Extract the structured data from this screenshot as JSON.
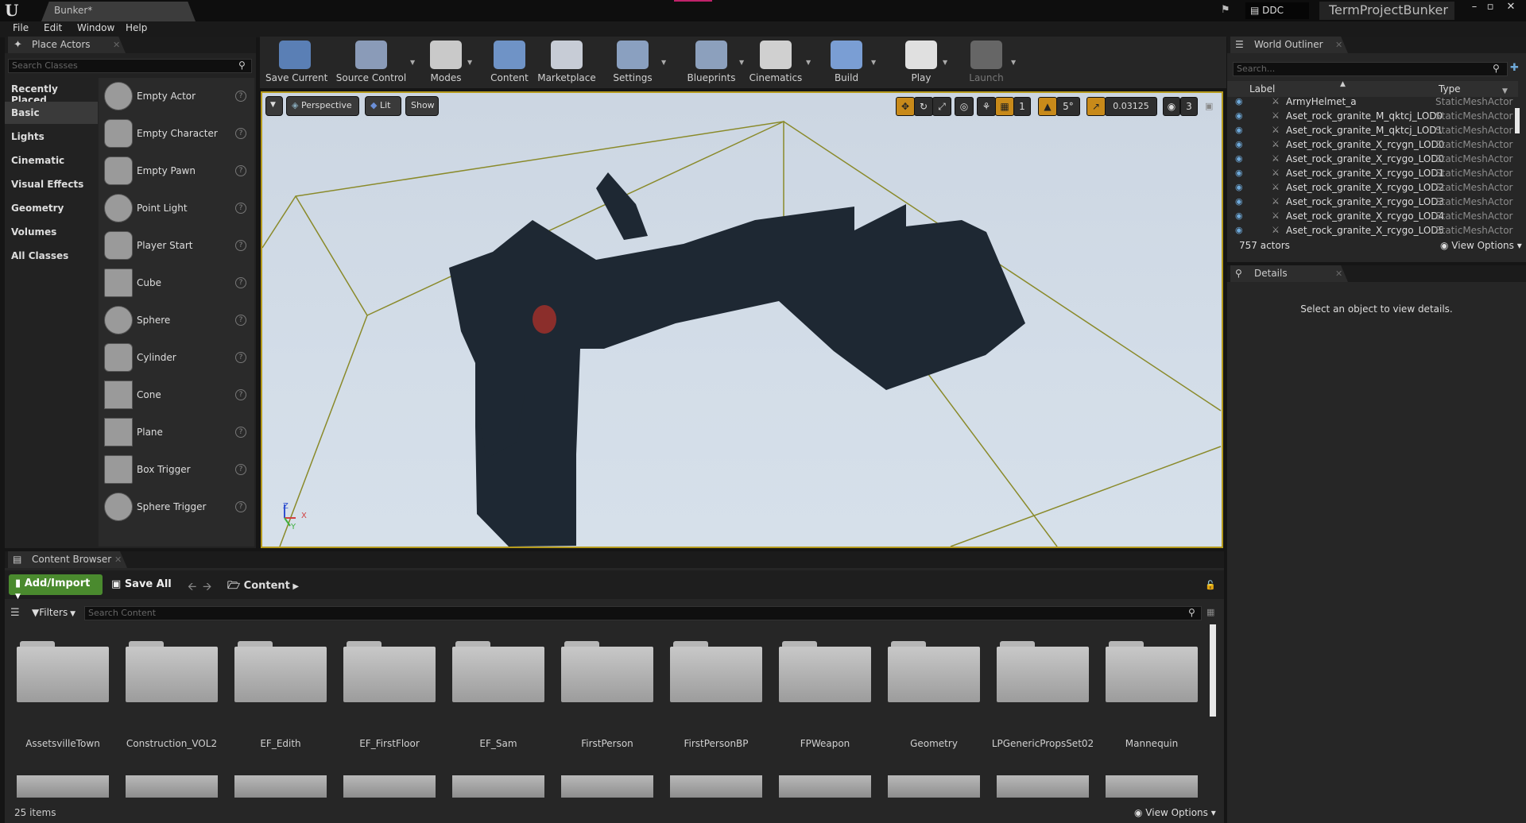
{
  "titlebar": {
    "doc_tab": "Bunker*",
    "ddc": "DDC",
    "project": "TermProjectBunker",
    "minimize": "–",
    "restore": "▫",
    "close": "✕"
  },
  "menu": [
    "File",
    "Edit",
    "Window",
    "Help"
  ],
  "place_actors": {
    "tab": "Place Actors",
    "search_placeholder": "Search Classes",
    "categories": [
      "Recently Placed",
      "Basic",
      "Lights",
      "Cinematic",
      "Visual Effects",
      "Geometry",
      "Volumes",
      "All Classes"
    ],
    "selected_category": "Basic",
    "items": [
      "Empty Actor",
      "Empty Character",
      "Empty Pawn",
      "Point Light",
      "Player Start",
      "Cube",
      "Sphere",
      "Cylinder",
      "Cone",
      "Plane",
      "Box Trigger",
      "Sphere Trigger"
    ]
  },
  "toolbar": [
    {
      "label": "Save Current",
      "icon": "save-icon",
      "color": "#5a7fb5"
    },
    {
      "label": "Source Control",
      "icon": "source-control-icon",
      "color": "#8a9bb8"
    },
    {
      "label": "Modes",
      "icon": "modes-icon",
      "color": "#c9c9c9"
    },
    {
      "label": "Content",
      "icon": "content-icon",
      "color": "#6f93c6"
    },
    {
      "label": "Marketplace",
      "icon": "marketplace-icon",
      "color": "#c7ccd6"
    },
    {
      "label": "Settings",
      "icon": "settings-icon",
      "color": "#8aa0c0"
    },
    {
      "label": "Blueprints",
      "icon": "blueprints-icon",
      "color": "#8ca0bd"
    },
    {
      "label": "Cinematics",
      "icon": "cinematics-icon",
      "color": "#d0d0d0"
    },
    {
      "label": "Build",
      "icon": "build-icon",
      "color": "#7a9ed4"
    },
    {
      "label": "Play",
      "icon": "play-icon",
      "color": "#e0e0e0"
    },
    {
      "label": "Launch",
      "icon": "launch-icon",
      "color": "#666666"
    }
  ],
  "viewport": {
    "perspective": "Perspective",
    "lit": "Lit",
    "show": "Show",
    "grid_value": "1",
    "angle_value": "5°",
    "scale_value": "0.03125",
    "camera_speed": "3",
    "axis_z": "Z",
    "axis_x": "X",
    "axis_y": "Y"
  },
  "world_outliner": {
    "tab": "World Outliner",
    "search_placeholder": "Search...",
    "col_label": "Label",
    "col_type": "Type",
    "rows": [
      {
        "label": "ArmyHelmet_a",
        "type": "StaticMeshActor"
      },
      {
        "label": "Aset_rock_granite_M_qktcj_LOD0",
        "type": "StaticMeshActor"
      },
      {
        "label": "Aset_rock_granite_M_qktcj_LOD1",
        "type": "StaticMeshActor"
      },
      {
        "label": "Aset_rock_granite_X_rcygn_LOD0",
        "type": "StaticMeshActor"
      },
      {
        "label": "Aset_rock_granite_X_rcygo_LOD0",
        "type": "StaticMeshActor"
      },
      {
        "label": "Aset_rock_granite_X_rcygo_LOD1",
        "type": "StaticMeshActor"
      },
      {
        "label": "Aset_rock_granite_X_rcygo_LOD2",
        "type": "StaticMeshActor"
      },
      {
        "label": "Aset_rock_granite_X_rcygo_LOD3",
        "type": "StaticMeshActor"
      },
      {
        "label": "Aset_rock_granite_X_rcygo_LOD4",
        "type": "StaticMeshActor"
      },
      {
        "label": "Aset_rock_granite_X_rcygo_LOD5",
        "type": "StaticMeshActor"
      }
    ],
    "count": "757 actors",
    "view_options": "View Options"
  },
  "details": {
    "tab": "Details",
    "empty_text": "Select an object to view details."
  },
  "content_browser": {
    "tab": "Content Browser",
    "add_import": "Add/Import",
    "save_all": "Save All",
    "path": "Content",
    "filters": "Filters",
    "search_placeholder": "Search Content",
    "folders": [
      "AssetsvilleTown",
      "Construction_VOL2",
      "EF_Edith",
      "EF_FirstFloor",
      "EF_Sam",
      "FirstPerson",
      "FirstPersonBP",
      "FPWeapon",
      "Geometry",
      "LPGenericPropsSet02",
      "Mannequin"
    ],
    "item_count": "25 items",
    "view_options": "View Options"
  },
  "colors": {
    "accent": "#c0226a",
    "viewport_border": "#b59a1c",
    "add_import": "#4a8a2e",
    "bounds": "#8a8a2a"
  }
}
